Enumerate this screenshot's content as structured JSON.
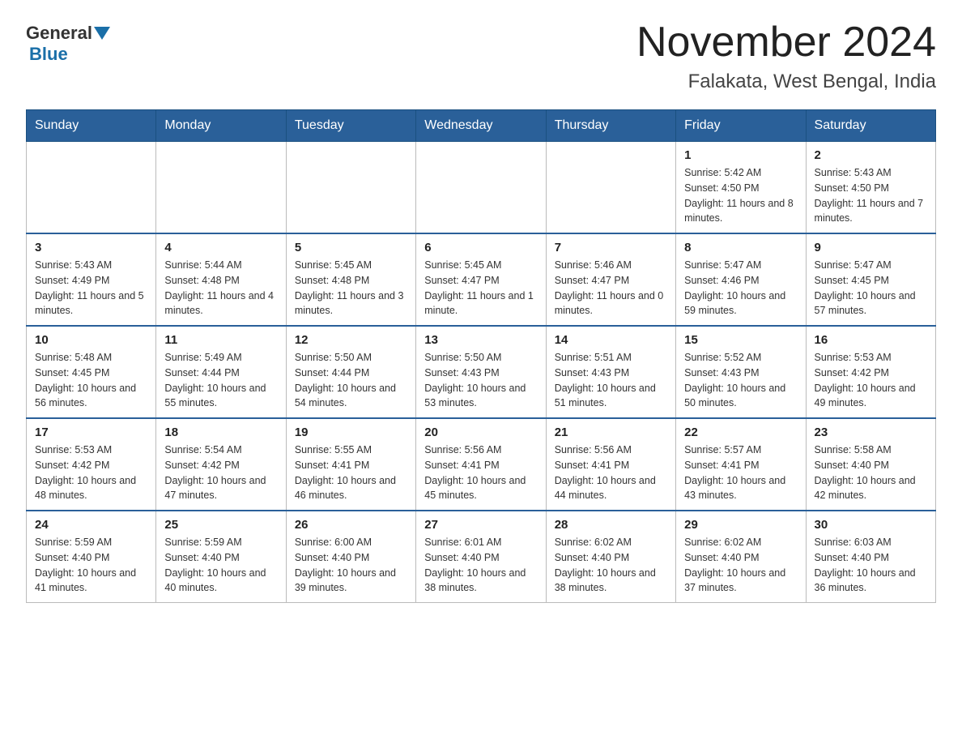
{
  "header": {
    "logo_general": "General",
    "logo_blue": "Blue",
    "month_title": "November 2024",
    "location": "Falakata, West Bengal, India"
  },
  "weekdays": [
    "Sunday",
    "Monday",
    "Tuesday",
    "Wednesday",
    "Thursday",
    "Friday",
    "Saturday"
  ],
  "weeks": [
    [
      {
        "day": "",
        "info": ""
      },
      {
        "day": "",
        "info": ""
      },
      {
        "day": "",
        "info": ""
      },
      {
        "day": "",
        "info": ""
      },
      {
        "day": "",
        "info": ""
      },
      {
        "day": "1",
        "info": "Sunrise: 5:42 AM\nSunset: 4:50 PM\nDaylight: 11 hours and 8 minutes."
      },
      {
        "day": "2",
        "info": "Sunrise: 5:43 AM\nSunset: 4:50 PM\nDaylight: 11 hours and 7 minutes."
      }
    ],
    [
      {
        "day": "3",
        "info": "Sunrise: 5:43 AM\nSunset: 4:49 PM\nDaylight: 11 hours and 5 minutes."
      },
      {
        "day": "4",
        "info": "Sunrise: 5:44 AM\nSunset: 4:48 PM\nDaylight: 11 hours and 4 minutes."
      },
      {
        "day": "5",
        "info": "Sunrise: 5:45 AM\nSunset: 4:48 PM\nDaylight: 11 hours and 3 minutes."
      },
      {
        "day": "6",
        "info": "Sunrise: 5:45 AM\nSunset: 4:47 PM\nDaylight: 11 hours and 1 minute."
      },
      {
        "day": "7",
        "info": "Sunrise: 5:46 AM\nSunset: 4:47 PM\nDaylight: 11 hours and 0 minutes."
      },
      {
        "day": "8",
        "info": "Sunrise: 5:47 AM\nSunset: 4:46 PM\nDaylight: 10 hours and 59 minutes."
      },
      {
        "day": "9",
        "info": "Sunrise: 5:47 AM\nSunset: 4:45 PM\nDaylight: 10 hours and 57 minutes."
      }
    ],
    [
      {
        "day": "10",
        "info": "Sunrise: 5:48 AM\nSunset: 4:45 PM\nDaylight: 10 hours and 56 minutes."
      },
      {
        "day": "11",
        "info": "Sunrise: 5:49 AM\nSunset: 4:44 PM\nDaylight: 10 hours and 55 minutes."
      },
      {
        "day": "12",
        "info": "Sunrise: 5:50 AM\nSunset: 4:44 PM\nDaylight: 10 hours and 54 minutes."
      },
      {
        "day": "13",
        "info": "Sunrise: 5:50 AM\nSunset: 4:43 PM\nDaylight: 10 hours and 53 minutes."
      },
      {
        "day": "14",
        "info": "Sunrise: 5:51 AM\nSunset: 4:43 PM\nDaylight: 10 hours and 51 minutes."
      },
      {
        "day": "15",
        "info": "Sunrise: 5:52 AM\nSunset: 4:43 PM\nDaylight: 10 hours and 50 minutes."
      },
      {
        "day": "16",
        "info": "Sunrise: 5:53 AM\nSunset: 4:42 PM\nDaylight: 10 hours and 49 minutes."
      }
    ],
    [
      {
        "day": "17",
        "info": "Sunrise: 5:53 AM\nSunset: 4:42 PM\nDaylight: 10 hours and 48 minutes."
      },
      {
        "day": "18",
        "info": "Sunrise: 5:54 AM\nSunset: 4:42 PM\nDaylight: 10 hours and 47 minutes."
      },
      {
        "day": "19",
        "info": "Sunrise: 5:55 AM\nSunset: 4:41 PM\nDaylight: 10 hours and 46 minutes."
      },
      {
        "day": "20",
        "info": "Sunrise: 5:56 AM\nSunset: 4:41 PM\nDaylight: 10 hours and 45 minutes."
      },
      {
        "day": "21",
        "info": "Sunrise: 5:56 AM\nSunset: 4:41 PM\nDaylight: 10 hours and 44 minutes."
      },
      {
        "day": "22",
        "info": "Sunrise: 5:57 AM\nSunset: 4:41 PM\nDaylight: 10 hours and 43 minutes."
      },
      {
        "day": "23",
        "info": "Sunrise: 5:58 AM\nSunset: 4:40 PM\nDaylight: 10 hours and 42 minutes."
      }
    ],
    [
      {
        "day": "24",
        "info": "Sunrise: 5:59 AM\nSunset: 4:40 PM\nDaylight: 10 hours and 41 minutes."
      },
      {
        "day": "25",
        "info": "Sunrise: 5:59 AM\nSunset: 4:40 PM\nDaylight: 10 hours and 40 minutes."
      },
      {
        "day": "26",
        "info": "Sunrise: 6:00 AM\nSunset: 4:40 PM\nDaylight: 10 hours and 39 minutes."
      },
      {
        "day": "27",
        "info": "Sunrise: 6:01 AM\nSunset: 4:40 PM\nDaylight: 10 hours and 38 minutes."
      },
      {
        "day": "28",
        "info": "Sunrise: 6:02 AM\nSunset: 4:40 PM\nDaylight: 10 hours and 38 minutes."
      },
      {
        "day": "29",
        "info": "Sunrise: 6:02 AM\nSunset: 4:40 PM\nDaylight: 10 hours and 37 minutes."
      },
      {
        "day": "30",
        "info": "Sunrise: 6:03 AM\nSunset: 4:40 PM\nDaylight: 10 hours and 36 minutes."
      }
    ]
  ]
}
